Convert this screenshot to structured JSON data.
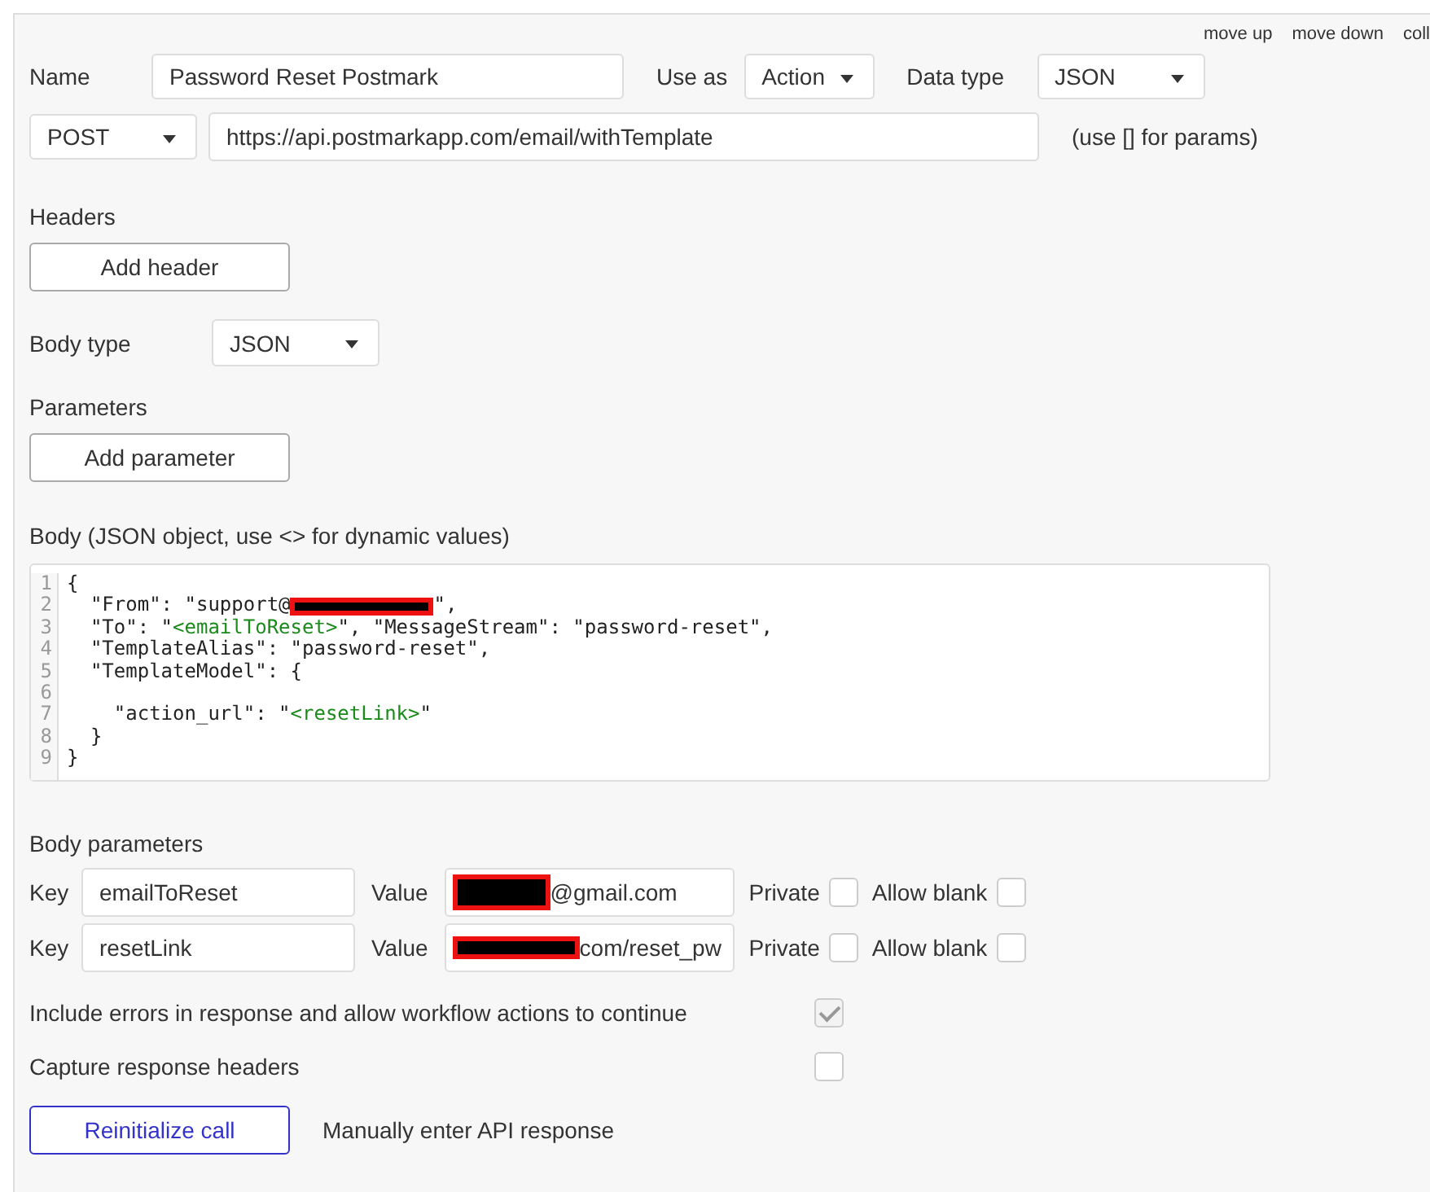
{
  "top_links": [
    "move up",
    "move down",
    "coll"
  ],
  "name": {
    "label": "Name",
    "value": "Password Reset Postmark"
  },
  "use_as": {
    "label": "Use as",
    "value": "Action"
  },
  "data_type": {
    "label": "Data type",
    "value": "JSON"
  },
  "method": {
    "value": "POST"
  },
  "url": {
    "value": "https://api.postmarkapp.com/email/withTemplate",
    "hint": "(use [] for params)"
  },
  "headers": {
    "label": "Headers",
    "button": "Add header"
  },
  "body_type": {
    "label": "Body type",
    "value": "JSON"
  },
  "parameters": {
    "label": "Parameters",
    "button": "Add parameter"
  },
  "body": {
    "label": "Body (JSON object, use <> for dynamic values)",
    "lines": [
      {
        "number": "1",
        "segments": [
          {
            "kind": "text",
            "text": "{"
          }
        ]
      },
      {
        "number": "2",
        "segments": [
          {
            "kind": "text",
            "text": "  \"From\": \"support@"
          },
          {
            "kind": "redacted"
          },
          {
            "kind": "text",
            "text": "\","
          }
        ]
      },
      {
        "number": "3",
        "segments": [
          {
            "kind": "text",
            "text": "  \"To\": \""
          },
          {
            "kind": "var",
            "text": "<emailToReset>"
          },
          {
            "kind": "text",
            "text": "\", \"MessageStream\": \"password-reset\","
          }
        ]
      },
      {
        "number": "4",
        "segments": [
          {
            "kind": "text",
            "text": "  \"TemplateAlias\": \"password-reset\","
          }
        ]
      },
      {
        "number": "5",
        "segments": [
          {
            "kind": "text",
            "text": "  \"TemplateModel\": {"
          }
        ]
      },
      {
        "number": "6"
      },
      {
        "number": "7",
        "segments": [
          {
            "kind": "text",
            "text": "    \"action_url\": \""
          },
          {
            "kind": "var",
            "text": "<resetLink>"
          },
          {
            "kind": "text",
            "text": "\""
          }
        ]
      },
      {
        "number": "8",
        "segments": [
          {
            "kind": "text",
            "text": "  }"
          }
        ]
      },
      {
        "number": "9",
        "segments": [
          {
            "kind": "text",
            "text": "}"
          }
        ]
      }
    ]
  },
  "body_parameters": {
    "label": "Body parameters",
    "rows": [
      {
        "key_label": "Key",
        "key": "emailToReset",
        "value_label": "Value",
        "value_redacted": true,
        "value": "@gmail.com",
        "private_label": "Private",
        "private": false,
        "allow_blank_label": "Allow blank",
        "allow_blank": false
      },
      {
        "key_label": "Key",
        "key": "resetLink",
        "value_label": "Value",
        "value_redacted": true,
        "value": "com/reset_pw",
        "private_label": "Private",
        "private": false,
        "allow_blank_label": "Allow blank",
        "allow_blank": false
      }
    ]
  },
  "options": [
    {
      "label": "Include errors in response and allow workflow actions to continue",
      "checked": true,
      "disabled": true
    },
    {
      "label": "Capture response headers",
      "checked": false,
      "disabled": false
    }
  ],
  "reinitialize_button": "Reinitialize call",
  "manual_link": "Manually enter API response"
}
